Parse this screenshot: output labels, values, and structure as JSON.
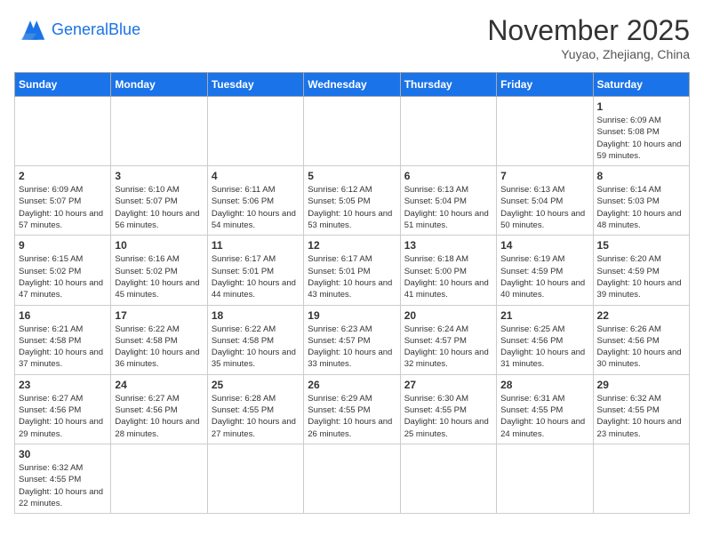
{
  "header": {
    "logo_line1": "General",
    "logo_line2": "Blue",
    "month": "November 2025",
    "location": "Yuyao, Zhejiang, China"
  },
  "weekdays": [
    "Sunday",
    "Monday",
    "Tuesday",
    "Wednesday",
    "Thursday",
    "Friday",
    "Saturday"
  ],
  "weeks": [
    [
      {
        "day": "",
        "info": ""
      },
      {
        "day": "",
        "info": ""
      },
      {
        "day": "",
        "info": ""
      },
      {
        "day": "",
        "info": ""
      },
      {
        "day": "",
        "info": ""
      },
      {
        "day": "",
        "info": ""
      },
      {
        "day": "1",
        "info": "Sunrise: 6:09 AM\nSunset: 5:08 PM\nDaylight: 10 hours and 59 minutes."
      }
    ],
    [
      {
        "day": "2",
        "info": "Sunrise: 6:09 AM\nSunset: 5:07 PM\nDaylight: 10 hours and 57 minutes."
      },
      {
        "day": "3",
        "info": "Sunrise: 6:10 AM\nSunset: 5:07 PM\nDaylight: 10 hours and 56 minutes."
      },
      {
        "day": "4",
        "info": "Sunrise: 6:11 AM\nSunset: 5:06 PM\nDaylight: 10 hours and 54 minutes."
      },
      {
        "day": "5",
        "info": "Sunrise: 6:12 AM\nSunset: 5:05 PM\nDaylight: 10 hours and 53 minutes."
      },
      {
        "day": "6",
        "info": "Sunrise: 6:13 AM\nSunset: 5:04 PM\nDaylight: 10 hours and 51 minutes."
      },
      {
        "day": "7",
        "info": "Sunrise: 6:13 AM\nSunset: 5:04 PM\nDaylight: 10 hours and 50 minutes."
      },
      {
        "day": "8",
        "info": "Sunrise: 6:14 AM\nSunset: 5:03 PM\nDaylight: 10 hours and 48 minutes."
      }
    ],
    [
      {
        "day": "9",
        "info": "Sunrise: 6:15 AM\nSunset: 5:02 PM\nDaylight: 10 hours and 47 minutes."
      },
      {
        "day": "10",
        "info": "Sunrise: 6:16 AM\nSunset: 5:02 PM\nDaylight: 10 hours and 45 minutes."
      },
      {
        "day": "11",
        "info": "Sunrise: 6:17 AM\nSunset: 5:01 PM\nDaylight: 10 hours and 44 minutes."
      },
      {
        "day": "12",
        "info": "Sunrise: 6:17 AM\nSunset: 5:01 PM\nDaylight: 10 hours and 43 minutes."
      },
      {
        "day": "13",
        "info": "Sunrise: 6:18 AM\nSunset: 5:00 PM\nDaylight: 10 hours and 41 minutes."
      },
      {
        "day": "14",
        "info": "Sunrise: 6:19 AM\nSunset: 4:59 PM\nDaylight: 10 hours and 40 minutes."
      },
      {
        "day": "15",
        "info": "Sunrise: 6:20 AM\nSunset: 4:59 PM\nDaylight: 10 hours and 39 minutes."
      }
    ],
    [
      {
        "day": "16",
        "info": "Sunrise: 6:21 AM\nSunset: 4:58 PM\nDaylight: 10 hours and 37 minutes."
      },
      {
        "day": "17",
        "info": "Sunrise: 6:22 AM\nSunset: 4:58 PM\nDaylight: 10 hours and 36 minutes."
      },
      {
        "day": "18",
        "info": "Sunrise: 6:22 AM\nSunset: 4:58 PM\nDaylight: 10 hours and 35 minutes."
      },
      {
        "day": "19",
        "info": "Sunrise: 6:23 AM\nSunset: 4:57 PM\nDaylight: 10 hours and 33 minutes."
      },
      {
        "day": "20",
        "info": "Sunrise: 6:24 AM\nSunset: 4:57 PM\nDaylight: 10 hours and 32 minutes."
      },
      {
        "day": "21",
        "info": "Sunrise: 6:25 AM\nSunset: 4:56 PM\nDaylight: 10 hours and 31 minutes."
      },
      {
        "day": "22",
        "info": "Sunrise: 6:26 AM\nSunset: 4:56 PM\nDaylight: 10 hours and 30 minutes."
      }
    ],
    [
      {
        "day": "23",
        "info": "Sunrise: 6:27 AM\nSunset: 4:56 PM\nDaylight: 10 hours and 29 minutes."
      },
      {
        "day": "24",
        "info": "Sunrise: 6:27 AM\nSunset: 4:56 PM\nDaylight: 10 hours and 28 minutes."
      },
      {
        "day": "25",
        "info": "Sunrise: 6:28 AM\nSunset: 4:55 PM\nDaylight: 10 hours and 27 minutes."
      },
      {
        "day": "26",
        "info": "Sunrise: 6:29 AM\nSunset: 4:55 PM\nDaylight: 10 hours and 26 minutes."
      },
      {
        "day": "27",
        "info": "Sunrise: 6:30 AM\nSunset: 4:55 PM\nDaylight: 10 hours and 25 minutes."
      },
      {
        "day": "28",
        "info": "Sunrise: 6:31 AM\nSunset: 4:55 PM\nDaylight: 10 hours and 24 minutes."
      },
      {
        "day": "29",
        "info": "Sunrise: 6:32 AM\nSunset: 4:55 PM\nDaylight: 10 hours and 23 minutes."
      }
    ],
    [
      {
        "day": "30",
        "info": "Sunrise: 6:32 AM\nSunset: 4:55 PM\nDaylight: 10 hours and 22 minutes."
      },
      {
        "day": "",
        "info": ""
      },
      {
        "day": "",
        "info": ""
      },
      {
        "day": "",
        "info": ""
      },
      {
        "day": "",
        "info": ""
      },
      {
        "day": "",
        "info": ""
      },
      {
        "day": "",
        "info": ""
      }
    ]
  ]
}
